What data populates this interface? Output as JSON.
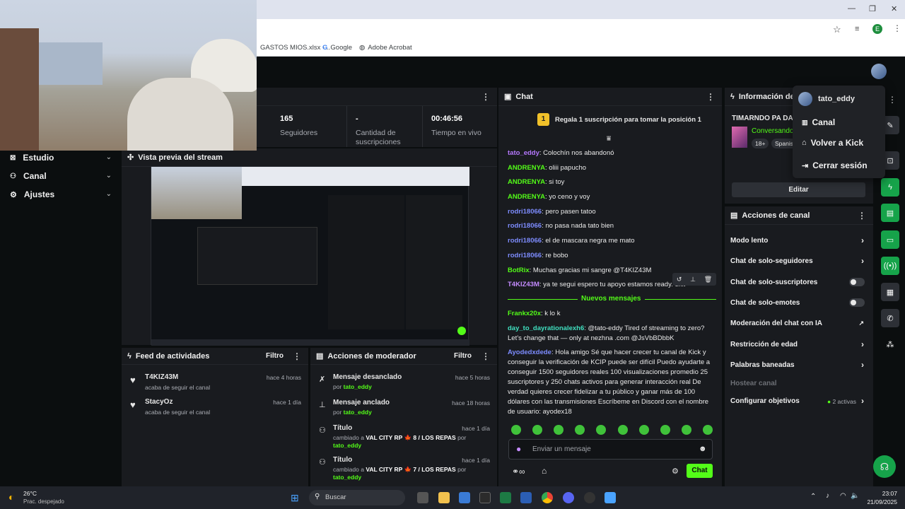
{
  "browser": {
    "bookmarks": [
      "GASTOS MIOS.xlsx -...",
      "Google",
      "Adobe Acrobat"
    ],
    "profile_initial": "E"
  },
  "sidebar": {
    "items": [
      {
        "label": "Estudio",
        "icon": "studio-icon"
      },
      {
        "label": "Canal",
        "icon": "channel-icon"
      },
      {
        "label": "Ajustes",
        "icon": "gear-icon"
      }
    ]
  },
  "stats": [
    {
      "value": "165",
      "label": "Seguidores"
    },
    {
      "value": "-",
      "label": "Cantidad de suscripciones"
    },
    {
      "value": "00:46:56",
      "label": "Tiempo en vivo"
    }
  ],
  "preview": {
    "title": "Vista previa del stream"
  },
  "activity_feed": {
    "title": "Feed de actividades",
    "filter_label": "Filtro",
    "items": [
      {
        "user": "T4KIZ43M",
        "text": "acaba de seguir el canal",
        "time": "hace 4 horas"
      },
      {
        "user": "StacyOz",
        "text": "acaba de seguir el canal",
        "time": "hace 1 día"
      }
    ]
  },
  "mod_actions": {
    "title": "Acciones de moderador",
    "filter_label": "Filtro",
    "items": [
      {
        "title": "Mensaje desanclado",
        "by_prefix": "por ",
        "user": "tato_eddy",
        "time": "hace 5 horas"
      },
      {
        "title": "Mensaje anclado",
        "by_prefix": "por ",
        "user": "tato_eddy",
        "time": "hace 18 horas"
      },
      {
        "title": "Título",
        "change_prefix": "cambiado a ",
        "change_value": "VAL CITY RP 🍁 8 / LOS REPAS",
        "by_prefix": " por ",
        "user": "tato_eddy",
        "time": "hace 1 día"
      },
      {
        "title": "Título",
        "change_prefix": "cambiado a ",
        "change_value": "VAL CITY RP 🍁 7 / LOS REPAS",
        "by_prefix": " por ",
        "user": "tato_eddy",
        "time": "hace 1 día"
      }
    ]
  },
  "chat": {
    "title": "Chat",
    "gift_badge": "1",
    "gift_text": "Regala 1 suscripción para tomar la posición 1",
    "messages_before": [
      {
        "user": "tato_eddy",
        "text": "Colochín nos abandonó",
        "color": "u-purple"
      },
      {
        "user": "ANDRENYA",
        "text": "oliii papucho",
        "color": "u-green"
      },
      {
        "user": "ANDRENYA",
        "text": "si toy",
        "color": "u-green"
      },
      {
        "user": "ANDRENYA",
        "text": "yo ceno y voy",
        "color": "u-green"
      },
      {
        "user": "rodri18066",
        "text": "pero pasen tatoo",
        "color": "u-blue"
      },
      {
        "user": "rodri18066",
        "text": "no pasa nada tato bien",
        "color": "u-blue"
      },
      {
        "user": "rodri18066",
        "text": "el de mascara negra me mato",
        "color": "u-blue"
      },
      {
        "user": "rodri18066",
        "text": "re bobo",
        "color": "u-blue"
      },
      {
        "user": "BotRix",
        "text": "Muchas gracias mi sangre @T4KIZ43M",
        "color": "u-green"
      },
      {
        "user": "T4KIZ43M",
        "text": "ya te segui espero tu apoyo estamos ready. exit",
        "color": "u-violet"
      }
    ],
    "new_messages_label": "Nuevos mensajes",
    "messages_after": [
      {
        "user": "Frankx20x",
        "text": "k lo k",
        "color": "u-green"
      },
      {
        "user": "day_to_dayrationalexh6",
        "text": "@tato-eddy Tired of streaming to zero? Let’s change that — only at nezhna .com @JsVbBDbbK",
        "color": "u-teal"
      },
      {
        "user": "Ayodedxdede",
        "text": "Hola amigo Sé que hacer crecer tu canal de Kick y conseguir la verificación de KCIP puede ser difícil Puedo ayudarte a conseguir 1500 seguidores reales 100 visualizaciones promedio 25 suscriptores y 250 chats activos para generar interacción real De verdad quieres crecer fidelizar a tu público y ganar más de 100 dólares con las transmisiones Escríbeme en Discord con el nombre de usuario: ayodex18",
        "color": "u-blue"
      }
    ],
    "input_placeholder": "Enviar un mensaje",
    "send_label": "Chat"
  },
  "channel_info": {
    "title": "Información del canal",
    "stream_title": "TIMARNDO PA DAR",
    "category": "Conversando",
    "tags": [
      "18+",
      "Spanish"
    ],
    "edit_label": "Editar"
  },
  "channel_actions": {
    "title": "Acciones de canal",
    "rows": [
      {
        "label": "Modo lento",
        "control": "chevron"
      },
      {
        "label": "Chat de solo-seguidores",
        "control": "chevron"
      },
      {
        "label": "Chat de solo-suscriptores",
        "control": "toggle"
      },
      {
        "label": "Chat de solo-emotes",
        "control": "toggle"
      },
      {
        "label": "Moderación del chat con IA",
        "control": "external"
      },
      {
        "label": "Restricción de edad",
        "control": "chevron"
      },
      {
        "label": "Palabras baneadas",
        "control": "chevron"
      },
      {
        "label": "Hostear canal",
        "control": "none"
      },
      {
        "label": "Configurar objetivos",
        "control": "goals",
        "extra": "2 activas"
      }
    ]
  },
  "user_menu": {
    "username": "tato_eddy",
    "items": [
      "Canal",
      "Volver a Kick",
      "Cerrar sesión"
    ]
  },
  "taskbar": {
    "weather_temp": "26°C",
    "weather_desc": "Prac. despejado",
    "search_placeholder": "Buscar",
    "time": "23:07",
    "date": "21/09/2025"
  }
}
